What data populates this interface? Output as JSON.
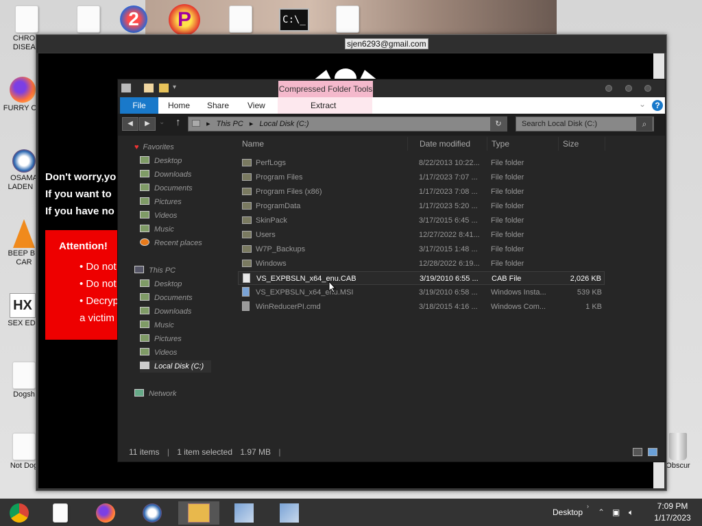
{
  "desktop": {
    "icons": [
      {
        "label": "CHRON DISEAS",
        "icon": "document-icon"
      },
      {
        "label": "FURRY CU",
        "icon": "firefox-icon"
      },
      {
        "label": "OSAMA LADEN E",
        "icon": "obama-logo-icon"
      },
      {
        "label": "BEEP BE CAR",
        "icon": "vlc-cone-icon"
      },
      {
        "label": "SEX EDI",
        "icon": "hx-icon"
      },
      {
        "label": "Dogsh",
        "icon": "document-icon"
      },
      {
        "label": "Not Dog",
        "icon": "document-icon"
      },
      {
        "label": "Obscur",
        "icon": "recycle-bin-icon"
      }
    ]
  },
  "ransom": {
    "email": "sjen6293@gmail.com",
    "lines": [
      "Don't worry,yo",
      "If you want to",
      "If you have no"
    ],
    "attention_title": "Attention!",
    "bullets": [
      "Do not r",
      "Do not t",
      "Decryptio"
    ],
    "bullet_tail": "a victim"
  },
  "explorer": {
    "context_tab": "Compressed Folder Tools",
    "tabs": {
      "file": "File",
      "home": "Home",
      "share": "Share",
      "view": "View",
      "extract": "Extract"
    },
    "breadcrumb": [
      "This PC",
      "Local Disk (C:)"
    ],
    "search_placeholder": "Search Local Disk (C:)",
    "nav": {
      "favorites_label": "Favorites",
      "favorites": [
        "Desktop",
        "Downloads",
        "Documents",
        "Pictures",
        "Videos",
        "Music",
        "Recent places"
      ],
      "thispc_label": "This PC",
      "thispc": [
        "Desktop",
        "Documents",
        "Downloads",
        "Music",
        "Pictures",
        "Videos",
        "Local Disk (C:)"
      ],
      "network_label": "Network"
    },
    "columns": {
      "name": "Name",
      "date": "Date modified",
      "type": "Type",
      "size": "Size"
    },
    "files": [
      {
        "name": "PerfLogs",
        "date": "8/22/2013 10:22...",
        "type": "File folder",
        "size": ""
      },
      {
        "name": "Program Files",
        "date": "1/17/2023 7:07 ...",
        "type": "File folder",
        "size": ""
      },
      {
        "name": "Program Files (x86)",
        "date": "1/17/2023 7:08 ...",
        "type": "File folder",
        "size": ""
      },
      {
        "name": "ProgramData",
        "date": "1/17/2023 5:20 ...",
        "type": "File folder",
        "size": ""
      },
      {
        "name": "SkinPack",
        "date": "3/17/2015 6:45 ...",
        "type": "File folder",
        "size": ""
      },
      {
        "name": "Users",
        "date": "12/27/2022 8:41...",
        "type": "File folder",
        "size": ""
      },
      {
        "name": "W7P_Backups",
        "date": "3/17/2015 1:48 ...",
        "type": "File folder",
        "size": ""
      },
      {
        "name": "Windows",
        "date": "12/28/2022 6:19...",
        "type": "File folder",
        "size": ""
      },
      {
        "name": "VS_EXPBSLN_x64_enu.CAB",
        "date": "3/19/2010 6:55 ...",
        "type": "CAB File",
        "size": "2,026 KB"
      },
      {
        "name": "VS_EXPBSLN_x64_enu.MSI",
        "date": "3/19/2010 6:58 ...",
        "type": "Windows Insta...",
        "size": "539 KB"
      },
      {
        "name": "WinReducerPI.cmd",
        "date": "3/18/2015 4:16 ...",
        "type": "Windows Com...",
        "size": "1 KB"
      }
    ],
    "status": {
      "items": "11 items",
      "selected": "1 item selected",
      "size": "1.97 MB"
    }
  },
  "taskbar": {
    "desktop_label": "Desktop",
    "time": "7:09 PM",
    "date": "1/17/2023"
  }
}
